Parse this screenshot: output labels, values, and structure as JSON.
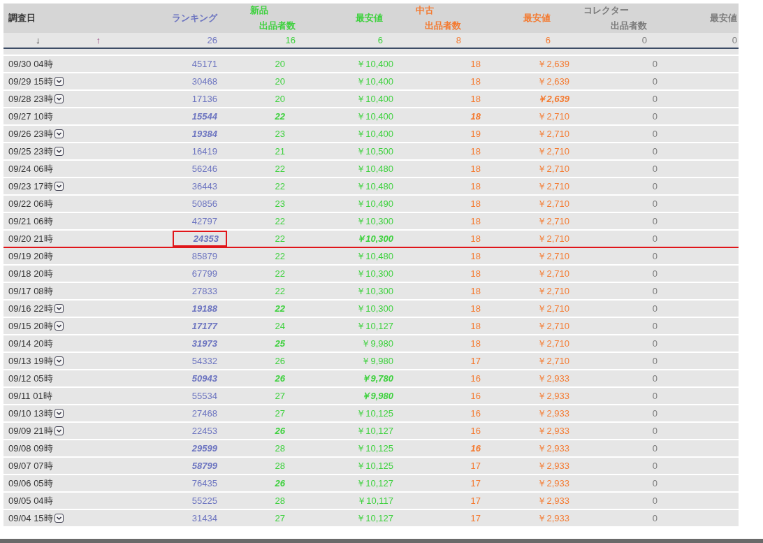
{
  "header": {
    "date": "調査日",
    "ranking": "ランキング",
    "groups": [
      {
        "name": "新品",
        "count": "出品者数",
        "price": "最安値"
      },
      {
        "name": "中古",
        "count": "出品者数",
        "price": "最安値"
      },
      {
        "name": "コレクター",
        "count": "出品者数",
        "price": "最安値"
      }
    ]
  },
  "summary": {
    "sort_down": "↓",
    "sort_up": "↑",
    "values": [
      "26",
      "16",
      "6",
      "8",
      "6",
      "0",
      "0"
    ]
  },
  "rows": [
    {
      "date": "09/30 04時",
      "dropdown": false,
      "rank_boxed": false,
      "line_below": false,
      "cells": [
        {
          "text": "45171",
          "em": false
        },
        {
          "text": "20",
          "em": false
        },
        {
          "text": "￥10,400",
          "em": false
        },
        {
          "text": "18",
          "em": false
        },
        {
          "text": "￥2,639",
          "em": false
        },
        {
          "text": "0",
          "em": false
        }
      ]
    },
    {
      "date": "09/29 15時",
      "dropdown": true,
      "rank_boxed": false,
      "line_below": false,
      "cells": [
        {
          "text": "30468",
          "em": false
        },
        {
          "text": "20",
          "em": false
        },
        {
          "text": "￥10,400",
          "em": false
        },
        {
          "text": "18",
          "em": false
        },
        {
          "text": "￥2,639",
          "em": false
        },
        {
          "text": "0",
          "em": false
        }
      ]
    },
    {
      "date": "09/28 23時",
      "dropdown": true,
      "rank_boxed": false,
      "line_below": false,
      "cells": [
        {
          "text": "17136",
          "em": false
        },
        {
          "text": "20",
          "em": false
        },
        {
          "text": "￥10,400",
          "em": false
        },
        {
          "text": "18",
          "em": false
        },
        {
          "text": "￥2,639",
          "em": true
        },
        {
          "text": "0",
          "em": false
        }
      ]
    },
    {
      "date": "09/27 10時",
      "dropdown": false,
      "rank_boxed": false,
      "line_below": false,
      "cells": [
        {
          "text": "15544",
          "em": true
        },
        {
          "text": "22",
          "em": true
        },
        {
          "text": "￥10,400",
          "em": false
        },
        {
          "text": "18",
          "em": true
        },
        {
          "text": "￥2,710",
          "em": false
        },
        {
          "text": "0",
          "em": false
        }
      ]
    },
    {
      "date": "09/26 23時",
      "dropdown": true,
      "rank_boxed": false,
      "line_below": false,
      "cells": [
        {
          "text": "19384",
          "em": true
        },
        {
          "text": "23",
          "em": false
        },
        {
          "text": "￥10,400",
          "em": false
        },
        {
          "text": "19",
          "em": false
        },
        {
          "text": "￥2,710",
          "em": false
        },
        {
          "text": "0",
          "em": false
        }
      ]
    },
    {
      "date": "09/25 23時",
      "dropdown": true,
      "rank_boxed": false,
      "line_below": false,
      "cells": [
        {
          "text": "16419",
          "em": false
        },
        {
          "text": "21",
          "em": false
        },
        {
          "text": "￥10,500",
          "em": false
        },
        {
          "text": "18",
          "em": false
        },
        {
          "text": "￥2,710",
          "em": false
        },
        {
          "text": "0",
          "em": false
        }
      ]
    },
    {
      "date": "09/24 06時",
      "dropdown": false,
      "rank_boxed": false,
      "line_below": false,
      "cells": [
        {
          "text": "56246",
          "em": false
        },
        {
          "text": "22",
          "em": false
        },
        {
          "text": "￥10,480",
          "em": false
        },
        {
          "text": "18",
          "em": false
        },
        {
          "text": "￥2,710",
          "em": false
        },
        {
          "text": "0",
          "em": false
        }
      ]
    },
    {
      "date": "09/23 17時",
      "dropdown": true,
      "rank_boxed": false,
      "line_below": false,
      "cells": [
        {
          "text": "36443",
          "em": false
        },
        {
          "text": "22",
          "em": false
        },
        {
          "text": "￥10,480",
          "em": false
        },
        {
          "text": "18",
          "em": false
        },
        {
          "text": "￥2,710",
          "em": false
        },
        {
          "text": "0",
          "em": false
        }
      ]
    },
    {
      "date": "09/22 06時",
      "dropdown": false,
      "rank_boxed": false,
      "line_below": false,
      "cells": [
        {
          "text": "50856",
          "em": false
        },
        {
          "text": "23",
          "em": false
        },
        {
          "text": "￥10,490",
          "em": false
        },
        {
          "text": "18",
          "em": false
        },
        {
          "text": "￥2,710",
          "em": false
        },
        {
          "text": "0",
          "em": false
        }
      ]
    },
    {
      "date": "09/21 06時",
      "dropdown": false,
      "rank_boxed": false,
      "line_below": false,
      "cells": [
        {
          "text": "42797",
          "em": false
        },
        {
          "text": "22",
          "em": false
        },
        {
          "text": "￥10,300",
          "em": false
        },
        {
          "text": "18",
          "em": false
        },
        {
          "text": "￥2,710",
          "em": false
        },
        {
          "text": "0",
          "em": false
        }
      ]
    },
    {
      "date": "09/20 21時",
      "dropdown": false,
      "rank_boxed": true,
      "line_below": true,
      "cells": [
        {
          "text": "24353",
          "em": true
        },
        {
          "text": "22",
          "em": false
        },
        {
          "text": "￥10,300",
          "em": true
        },
        {
          "text": "18",
          "em": false
        },
        {
          "text": "￥2,710",
          "em": false
        },
        {
          "text": "0",
          "em": false
        }
      ]
    },
    {
      "date": "09/19 20時",
      "dropdown": false,
      "rank_boxed": false,
      "line_below": false,
      "cells": [
        {
          "text": "85879",
          "em": false
        },
        {
          "text": "22",
          "em": false
        },
        {
          "text": "￥10,480",
          "em": false
        },
        {
          "text": "18",
          "em": false
        },
        {
          "text": "￥2,710",
          "em": false
        },
        {
          "text": "0",
          "em": false
        }
      ]
    },
    {
      "date": "09/18 20時",
      "dropdown": false,
      "rank_boxed": false,
      "line_below": false,
      "cells": [
        {
          "text": "67799",
          "em": false
        },
        {
          "text": "22",
          "em": false
        },
        {
          "text": "￥10,300",
          "em": false
        },
        {
          "text": "18",
          "em": false
        },
        {
          "text": "￥2,710",
          "em": false
        },
        {
          "text": "0",
          "em": false
        }
      ]
    },
    {
      "date": "09/17 08時",
      "dropdown": false,
      "rank_boxed": false,
      "line_below": false,
      "cells": [
        {
          "text": "27833",
          "em": false
        },
        {
          "text": "22",
          "em": false
        },
        {
          "text": "￥10,300",
          "em": false
        },
        {
          "text": "18",
          "em": false
        },
        {
          "text": "￥2,710",
          "em": false
        },
        {
          "text": "0",
          "em": false
        }
      ]
    },
    {
      "date": "09/16 22時",
      "dropdown": true,
      "rank_boxed": false,
      "line_below": false,
      "cells": [
        {
          "text": "19188",
          "em": true
        },
        {
          "text": "22",
          "em": true
        },
        {
          "text": "￥10,300",
          "em": false
        },
        {
          "text": "18",
          "em": false
        },
        {
          "text": "￥2,710",
          "em": false
        },
        {
          "text": "0",
          "em": false
        }
      ]
    },
    {
      "date": "09/15 20時",
      "dropdown": true,
      "rank_boxed": false,
      "line_below": false,
      "cells": [
        {
          "text": "17177",
          "em": true
        },
        {
          "text": "24",
          "em": false
        },
        {
          "text": "￥10,127",
          "em": false
        },
        {
          "text": "18",
          "em": false
        },
        {
          "text": "￥2,710",
          "em": false
        },
        {
          "text": "0",
          "em": false
        }
      ]
    },
    {
      "date": "09/14 20時",
      "dropdown": false,
      "rank_boxed": false,
      "line_below": false,
      "cells": [
        {
          "text": "31973",
          "em": true
        },
        {
          "text": "25",
          "em": true
        },
        {
          "text": "￥9,980",
          "em": false
        },
        {
          "text": "18",
          "em": false
        },
        {
          "text": "￥2,710",
          "em": false
        },
        {
          "text": "0",
          "em": false
        }
      ]
    },
    {
      "date": "09/13 19時",
      "dropdown": true,
      "rank_boxed": false,
      "line_below": false,
      "cells": [
        {
          "text": "54332",
          "em": false
        },
        {
          "text": "26",
          "em": false
        },
        {
          "text": "￥9,980",
          "em": false
        },
        {
          "text": "17",
          "em": false
        },
        {
          "text": "￥2,710",
          "em": false
        },
        {
          "text": "0",
          "em": false
        }
      ]
    },
    {
      "date": "09/12 05時",
      "dropdown": false,
      "rank_boxed": false,
      "line_below": false,
      "cells": [
        {
          "text": "50943",
          "em": true
        },
        {
          "text": "26",
          "em": true
        },
        {
          "text": "￥9,780",
          "em": true
        },
        {
          "text": "16",
          "em": false
        },
        {
          "text": "￥2,933",
          "em": false
        },
        {
          "text": "0",
          "em": false
        }
      ]
    },
    {
      "date": "09/11 01時",
      "dropdown": false,
      "rank_boxed": false,
      "line_below": false,
      "cells": [
        {
          "text": "55534",
          "em": false
        },
        {
          "text": "27",
          "em": false
        },
        {
          "text": "￥9,980",
          "em": true
        },
        {
          "text": "16",
          "em": false
        },
        {
          "text": "￥2,933",
          "em": false
        },
        {
          "text": "0",
          "em": false
        }
      ]
    },
    {
      "date": "09/10 13時",
      "dropdown": true,
      "rank_boxed": false,
      "line_below": false,
      "cells": [
        {
          "text": "27468",
          "em": false
        },
        {
          "text": "27",
          "em": false
        },
        {
          "text": "￥10,125",
          "em": false
        },
        {
          "text": "16",
          "em": false
        },
        {
          "text": "￥2,933",
          "em": false
        },
        {
          "text": "0",
          "em": false
        }
      ]
    },
    {
      "date": "09/09 21時",
      "dropdown": true,
      "rank_boxed": false,
      "line_below": false,
      "cells": [
        {
          "text": "22453",
          "em": false
        },
        {
          "text": "26",
          "em": true
        },
        {
          "text": "￥10,127",
          "em": false
        },
        {
          "text": "16",
          "em": false
        },
        {
          "text": "￥2,933",
          "em": false
        },
        {
          "text": "0",
          "em": false
        }
      ]
    },
    {
      "date": "09/08 09時",
      "dropdown": false,
      "rank_boxed": false,
      "line_below": false,
      "cells": [
        {
          "text": "29599",
          "em": true
        },
        {
          "text": "28",
          "em": false
        },
        {
          "text": "￥10,125",
          "em": false
        },
        {
          "text": "16",
          "em": true
        },
        {
          "text": "￥2,933",
          "em": false
        },
        {
          "text": "0",
          "em": false
        }
      ]
    },
    {
      "date": "09/07 07時",
      "dropdown": false,
      "rank_boxed": false,
      "line_below": false,
      "cells": [
        {
          "text": "58799",
          "em": true
        },
        {
          "text": "28",
          "em": false
        },
        {
          "text": "￥10,125",
          "em": false
        },
        {
          "text": "17",
          "em": false
        },
        {
          "text": "￥2,933",
          "em": false
        },
        {
          "text": "0",
          "em": false
        }
      ]
    },
    {
      "date": "09/06 05時",
      "dropdown": false,
      "rank_boxed": false,
      "line_below": false,
      "cells": [
        {
          "text": "76435",
          "em": false
        },
        {
          "text": "26",
          "em": true
        },
        {
          "text": "￥10,127",
          "em": false
        },
        {
          "text": "17",
          "em": false
        },
        {
          "text": "￥2,933",
          "em": false
        },
        {
          "text": "0",
          "em": false
        }
      ]
    },
    {
      "date": "09/05 04時",
      "dropdown": false,
      "rank_boxed": false,
      "line_below": false,
      "cells": [
        {
          "text": "55225",
          "em": false
        },
        {
          "text": "28",
          "em": false
        },
        {
          "text": "￥10,117",
          "em": false
        },
        {
          "text": "17",
          "em": false
        },
        {
          "text": "￥2,933",
          "em": false
        },
        {
          "text": "0",
          "em": false
        }
      ]
    },
    {
      "date": "09/04 15時",
      "dropdown": true,
      "rank_boxed": false,
      "line_below": false,
      "cells": [
        {
          "text": "31434",
          "em": false
        },
        {
          "text": "27",
          "em": false
        },
        {
          "text": "￥10,127",
          "em": false
        },
        {
          "text": "17",
          "em": false
        },
        {
          "text": "￥2,933",
          "em": false
        },
        {
          "text": "0",
          "em": false
        }
      ]
    }
  ]
}
